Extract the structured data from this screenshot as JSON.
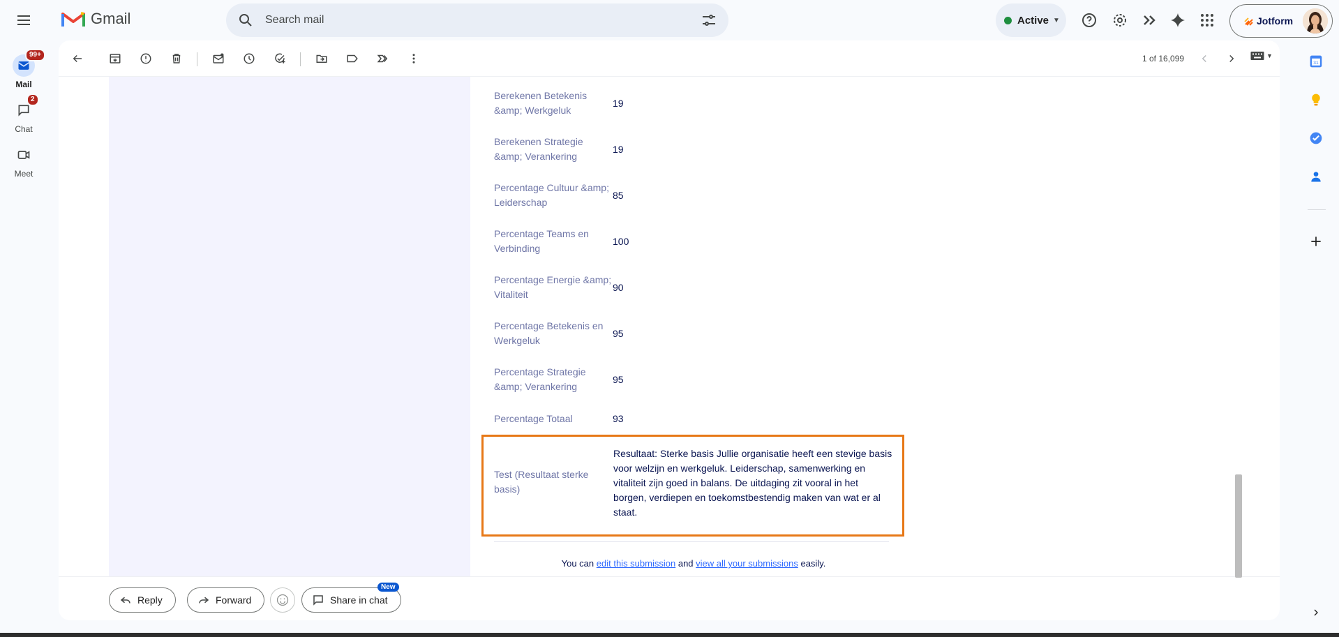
{
  "header": {
    "app_name": "Gmail",
    "search_placeholder": "Search mail",
    "status": "Active",
    "account_brand": "Jotform"
  },
  "leftnav": [
    {
      "label": "Mail",
      "badge": "99+"
    },
    {
      "label": "Chat",
      "badge": "2"
    },
    {
      "label": "Meet",
      "badge": ""
    }
  ],
  "toolbar": {
    "pager": "1 of 16,099"
  },
  "submission": {
    "rows": [
      {
        "label": "Berekenen Betekenis &amp; Werkgeluk",
        "value": "19"
      },
      {
        "label": "Berekenen Strategie &amp; Verankering",
        "value": "19"
      },
      {
        "label": "Percentage Cultuur &amp; Leiderschap",
        "value": "85"
      },
      {
        "label": "Percentage Teams en Verbinding",
        "value": "100"
      },
      {
        "label": "Percentage Energie &amp; Vitaliteit",
        "value": "90"
      },
      {
        "label": "Percentage Betekenis en Werkgeluk",
        "value": "95"
      },
      {
        "label": "Percentage Strategie &amp; Verankering",
        "value": "95"
      },
      {
        "label": "Percentage Totaal",
        "value": "93"
      }
    ],
    "highlight": {
      "label": "Test (Resultaat sterke basis)",
      "value": "Resultaat: Sterke basis  Jullie organisatie heeft een stevige basis voor welzijn en werkgeluk. Leiderschap, samenwerking en vitaliteit zijn goed in balans. De uitdaging zit vooral in het borgen, verdiepen en toekomstbestendig maken van wat er al staat."
    },
    "footer": {
      "prefix": "You can",
      "link1": "edit this submission",
      "middle": "and",
      "link2": "view all your submissions",
      "suffix": "easily."
    }
  },
  "reply_bar": {
    "reply": "Reply",
    "forward": "Forward",
    "share": "Share in chat",
    "new_badge": "New"
  },
  "colors": {
    "highlight_border": "#e77817",
    "label_text": "#6f76a7",
    "value_text": "#0a1551",
    "link": "#2e69ff"
  }
}
